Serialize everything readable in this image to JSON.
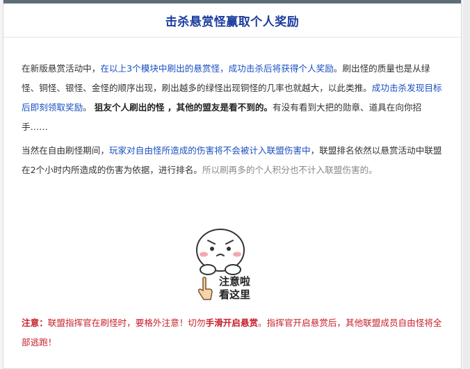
{
  "panel": {
    "title": "击杀悬赏怪赢取个人奖励"
  },
  "para1": {
    "s1": "在新版悬赏活动中，",
    "s2": "在以上3个模块中刷出的悬赏怪，成功击杀后将获得个人奖励",
    "s3": "。刷出怪的质量也是从绿怪、铜怪、银怪、金怪的顺序出现，刷出越多的绿怪出现铜怪的几率也就越大，以此类推。",
    "s4": "成功击杀发现目标后即刻领取奖励",
    "s5": "。 ",
    "s6": "狙友个人刷出的怪 ，其他的盟友是看不到的。",
    "s7": "有没有看到大把的勋章、道具在向你招手……"
  },
  "para2": {
    "s1": "当然在自由刷怪期间，",
    "s2": "玩家对自由怪所造成的伤害将不会被计入联盟伤害中",
    "s3": "，联盟排名依然以悬赏活动中联盟在2个小时内所造成的伤害为依据，进行排名。",
    "s4": "所以刷再多的个人积分也不计入联盟伤害的。"
  },
  "emoji": {
    "line1": "注意啦",
    "line2": "看这里",
    "icon": "pointing-finger-icon"
  },
  "notice": {
    "label": "注意：",
    "s1": "联盟指挥官在刷怪时，要格外注意！切勿",
    "s2": "手滑开启悬赏",
    "s3": "。指挥官开启悬赏后，其他联盟成员自由怪将全部逃跑！"
  },
  "colors": {
    "title": "#1a3c9e",
    "link_blue": "#1a4fc0",
    "warning_red": "#c8202a",
    "topbar": "#5c6e78"
  }
}
